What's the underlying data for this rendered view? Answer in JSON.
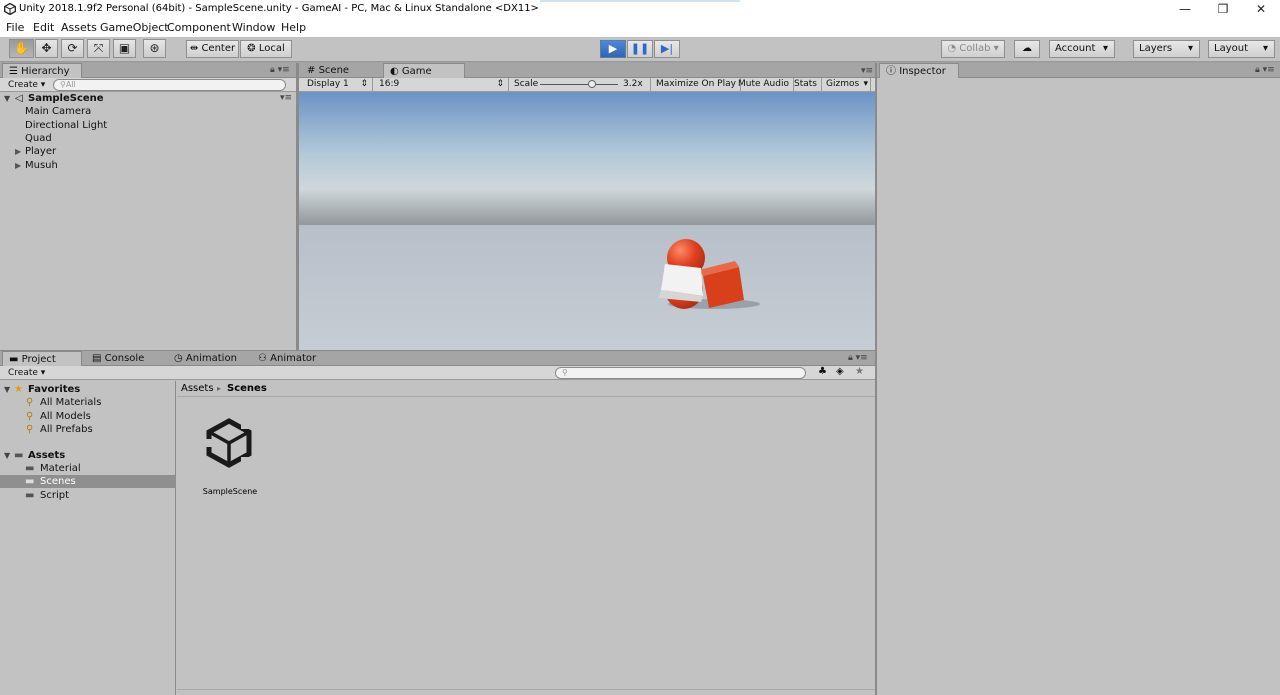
{
  "window": {
    "title": "Unity 2018.1.9f2 Personal (64bit) - SampleScene.unity - GameAI - PC, Mac & Linux Standalone <DX11>",
    "controls": {
      "minimize": "—",
      "maximize": "❐",
      "close": "✕"
    }
  },
  "menu": [
    "File",
    "Edit",
    "Assets",
    "GameObject",
    "Component",
    "Window",
    "Help"
  ],
  "toolbar": {
    "tools": [
      "hand-tool",
      "move-tool",
      "rotate-tool",
      "scale-tool",
      "rect-tool",
      "transform-tool"
    ],
    "pivot_label": "Center",
    "space_label": "Local",
    "playback": {
      "play": "▶",
      "pause": "❚❚",
      "step": "▶|"
    },
    "collab_label": "Collab",
    "account_label": "Account",
    "layers_label": "Layers",
    "layout_label": "Layout"
  },
  "hierarchy": {
    "tab_label": "Hierarchy",
    "create_label": "Create",
    "search_placeholder": "All",
    "scene_name": "SampleScene",
    "items": [
      {
        "label": "Main Camera",
        "expandable": false
      },
      {
        "label": "Directional Light",
        "expandable": false
      },
      {
        "label": "Quad",
        "expandable": false
      },
      {
        "label": "Player",
        "expandable": true
      },
      {
        "label": "Musuh",
        "expandable": true
      }
    ]
  },
  "views": {
    "scene_tab": "Scene",
    "game_tab": "Game",
    "display": "Display 1",
    "aspect": "16:9",
    "scale_label": "Scale",
    "scale_value": "3.2x",
    "maximize_on_play": "Maximize On Play",
    "mute_audio": "Mute Audio",
    "stats": "Stats",
    "gizmos": "Gizmos"
  },
  "project": {
    "tabs": [
      "Project",
      "Console",
      "Animation",
      "Animator"
    ],
    "create_label": "Create",
    "favorites_label": "Favorites",
    "favorites": [
      "All Materials",
      "All Models",
      "All Prefabs"
    ],
    "assets_label": "Assets",
    "folders": [
      "Material",
      "Scenes",
      "Script"
    ],
    "selected_folder": "Scenes",
    "breadcrumb": [
      "Assets",
      "Scenes"
    ],
    "breadcrumb_sep": "▸",
    "files": [
      {
        "name": "SampleScene",
        "icon": "unity-scene-icon"
      }
    ]
  },
  "inspector": {
    "tab_label": "Inspector"
  },
  "colors": {
    "play_active": "#2f64b0",
    "panel_bg": "#c2c2c2",
    "selection": "#8f8f8f"
  }
}
